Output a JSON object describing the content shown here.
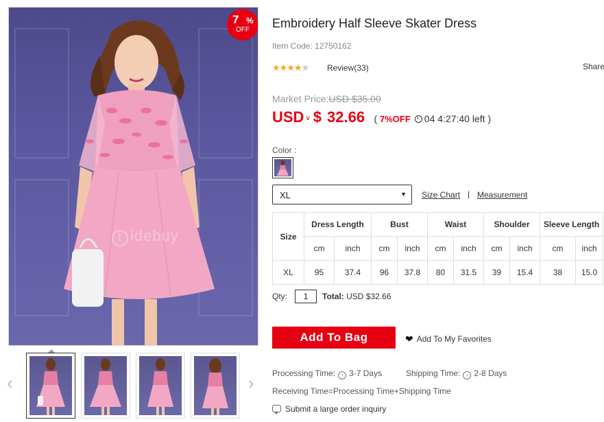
{
  "product": {
    "title": "Embroidery Half Sleeve Skater Dress",
    "item_code_label": "Item Code:",
    "item_code": "12750162",
    "rating": 4,
    "rating_max": 5,
    "review_label": "Review(33)",
    "share_label": "Share"
  },
  "badge": {
    "percent": "7",
    "percent_sign": "%",
    "off": "OFF"
  },
  "watermark": {
    "letter": "t",
    "text": "idebuy"
  },
  "pricing": {
    "market_label": "Market Price:",
    "market_price": "USD $35.00",
    "currency": "USD",
    "currency_caret": "»",
    "symbol": "$",
    "price": "32.66",
    "deal_open": "(",
    "deal_off": "7%OFF",
    "countdown": "04 4:27:40 left",
    "deal_close": ")"
  },
  "options": {
    "color_label": "Color :",
    "size_selected": "XL",
    "size_chart_link": "Size Chart",
    "separator": "|",
    "measurement_link": "Measurement"
  },
  "size_table": {
    "size_header": "Size",
    "columns": [
      "Dress Length",
      "Bust",
      "Waist",
      "Shoulder",
      "Sleeve Length"
    ],
    "units": [
      "cm",
      "inch",
      "cm",
      "inch",
      "cm",
      "inch",
      "cm",
      "inch",
      "cm",
      "inch"
    ],
    "rows": [
      {
        "size": "XL",
        "values": [
          "95",
          "37.4",
          "96",
          "37.8",
          "80",
          "31.5",
          "39",
          "15.4",
          "38",
          "15.0"
        ]
      }
    ]
  },
  "cart": {
    "qty_label": "Qty:",
    "qty_value": "1",
    "total_label": "Total:",
    "total_value": "USD $32.66",
    "add_to_bag": "Add To Bag",
    "favorites": "Add To My Favorites"
  },
  "shipping": {
    "processing_label": "Processing Time:",
    "processing_value": "3-7 Days",
    "shipping_label": "Shipping Time:",
    "shipping_value": "2-8 Days",
    "receiving": "Receiving Time=Processing Time+Shipping Time",
    "inquiry": "Submit a large order inquiry"
  },
  "icons": {
    "star": "star-icon",
    "clock": "clock-icon",
    "heart": "heart-icon",
    "chevron_left": "chevron-left-icon",
    "chevron_right": "chevron-right-icon",
    "chat": "chat-icon"
  },
  "colors": {
    "accent": "#e60012",
    "star": "#f5a623",
    "dress_pink": "#f0a0bf",
    "background_purple": "#5b58a0"
  }
}
